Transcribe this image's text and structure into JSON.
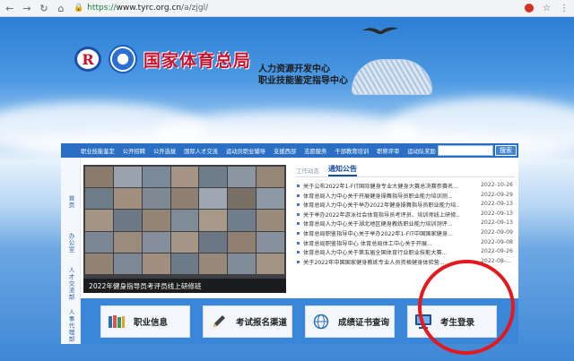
{
  "browser": {
    "url_scheme": "https://",
    "url_host": "www.tyrc.org.cn",
    "url_path": "/a/zjgl/"
  },
  "header": {
    "site_title": "国家体育总局",
    "sub_title_1": "人力资源开发中心",
    "sub_title_2": "职业技能鉴定指导中心",
    "logo_letter": "R"
  },
  "navbar": {
    "items": [
      "职业技能鉴定",
      "公开招聘",
      "公开选拔",
      "国际人才交流",
      "运动员职业辅导",
      "支援西部",
      "志愿服务",
      "干部教育培训",
      "职称评审",
      "运动队奖励"
    ],
    "search_button": "搜索"
  },
  "sidebar": {
    "items": [
      "首页",
      "办公室",
      "人才交流部",
      "人事代理部"
    ]
  },
  "photo": {
    "caption": "2022年健身指导员考评员线上研修班"
  },
  "news": {
    "tab_inactive": "工作动态",
    "tab_active": "通知公告",
    "rows": [
      {
        "title": "关于公布2022年1-FIT国际健身专业大健身大赛总决赛参赛名...",
        "date": "2022-10-26"
      },
      {
        "title": "体育总局人力中心关于开展健身操舞指导员职业能力培训测...",
        "date": "2022-09-29"
      },
      {
        "title": "体育总局人力中心关于举办2022年健身操舞指导员职业能力培...",
        "date": "2022-09-13"
      },
      {
        "title": "关于举办2022年游泳社会体育指导员考评员、培训师线上研修...",
        "date": "2022-09-13"
      },
      {
        "title": "体育总局人力中心关于湖北地区健身教练职业能力培训测评...",
        "date": "2022-09-13"
      },
      {
        "title": "体育总局职鉴指导中心关于举办2022年1-FIT中国国家健身...",
        "date": "2022-09-09"
      },
      {
        "title": "体育总局职鉴指导中心 体育总局体工中心关于开展...",
        "date": "2022-09-08"
      },
      {
        "title": "体育总局人力中心关于第五届全国体育行业职业技能大赛...",
        "date": "2022-09-26"
      },
      {
        "title": "关于2022年中国国家健身教练专业人员资格健身体验营...",
        "date": "2022-08-..."
      }
    ]
  },
  "quick_buttons": [
    {
      "label": "职业信息",
      "icon": "books-icon"
    },
    {
      "label": "考试报名渠道",
      "icon": "pencil-icon"
    },
    {
      "label": "成绩证书查询",
      "icon": "globe-icon"
    },
    {
      "label": "考生登录",
      "icon": "computer-icon"
    }
  ],
  "colors": {
    "nav_blue": "#2b6fc4",
    "title_red": "#c8102e",
    "annotation_red": "#e4181d"
  }
}
